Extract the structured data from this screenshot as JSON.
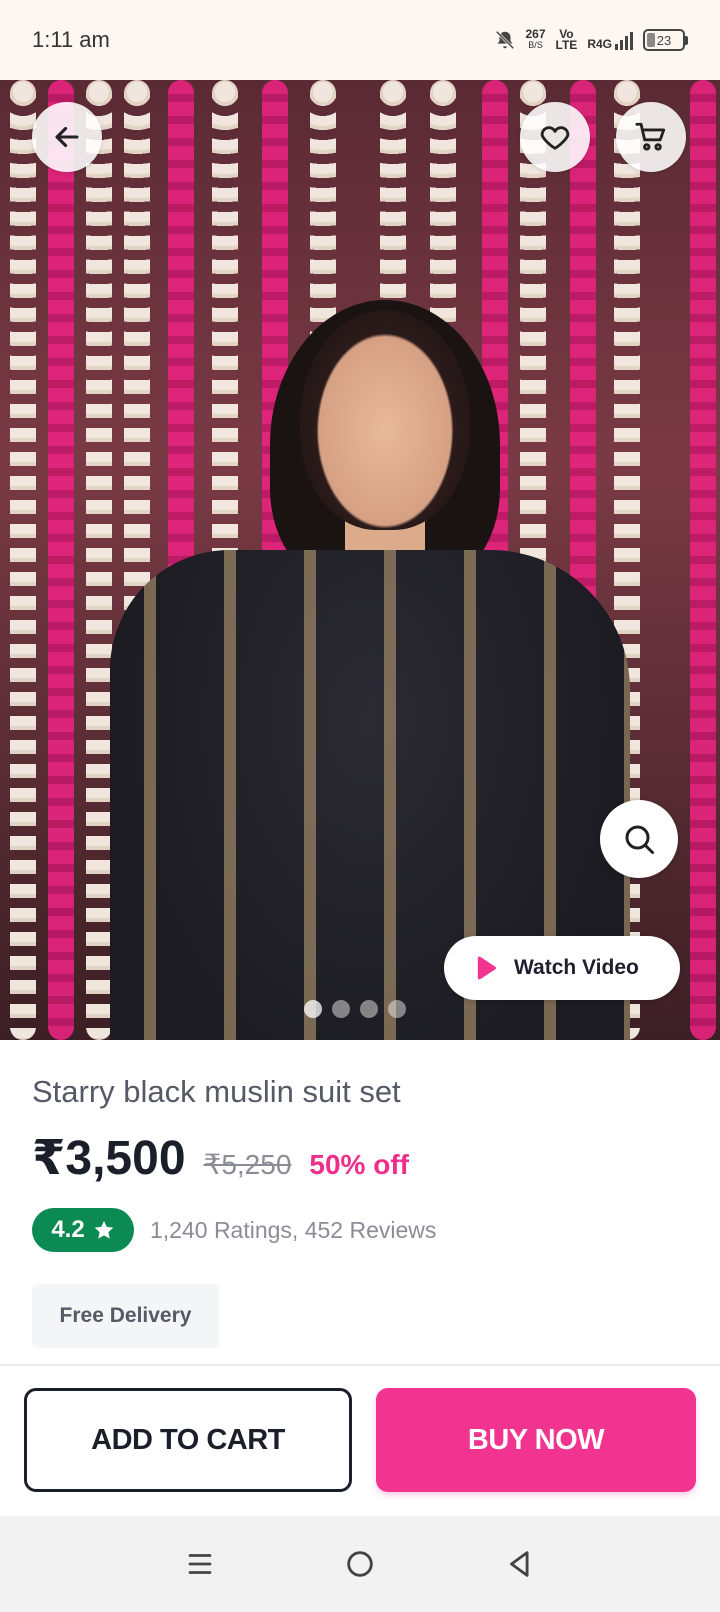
{
  "status_bar": {
    "time": "1:11 am",
    "data_speed": "267",
    "data_unit": "B/S",
    "volte_top": "Vo",
    "volte_bottom": "LTE",
    "network": "R4G",
    "battery": "23"
  },
  "hero": {
    "back_icon": "arrow-left-icon",
    "wishlist_icon": "heart-icon",
    "cart_icon": "shopping-cart-icon",
    "zoom_icon": "search-icon",
    "video_icon": "play-icon",
    "watch_video_label": "Watch Video",
    "image_count": 4,
    "active_image_index": 0
  },
  "product": {
    "title": "Starry black muslin suit set",
    "price": "₹3,500",
    "mrp": "₹5,250",
    "discount": "50% off",
    "rating": "4.2",
    "rating_summary": "1,240 Ratings, 452 Reviews",
    "delivery_tag": "Free Delivery"
  },
  "actions": {
    "add_to_cart": "ADD TO CART",
    "buy_now": "BUY NOW"
  },
  "colors": {
    "accent_pink": "#f0348f",
    "rating_green": "#0b8a53",
    "dark_text": "#1b1f2a"
  }
}
